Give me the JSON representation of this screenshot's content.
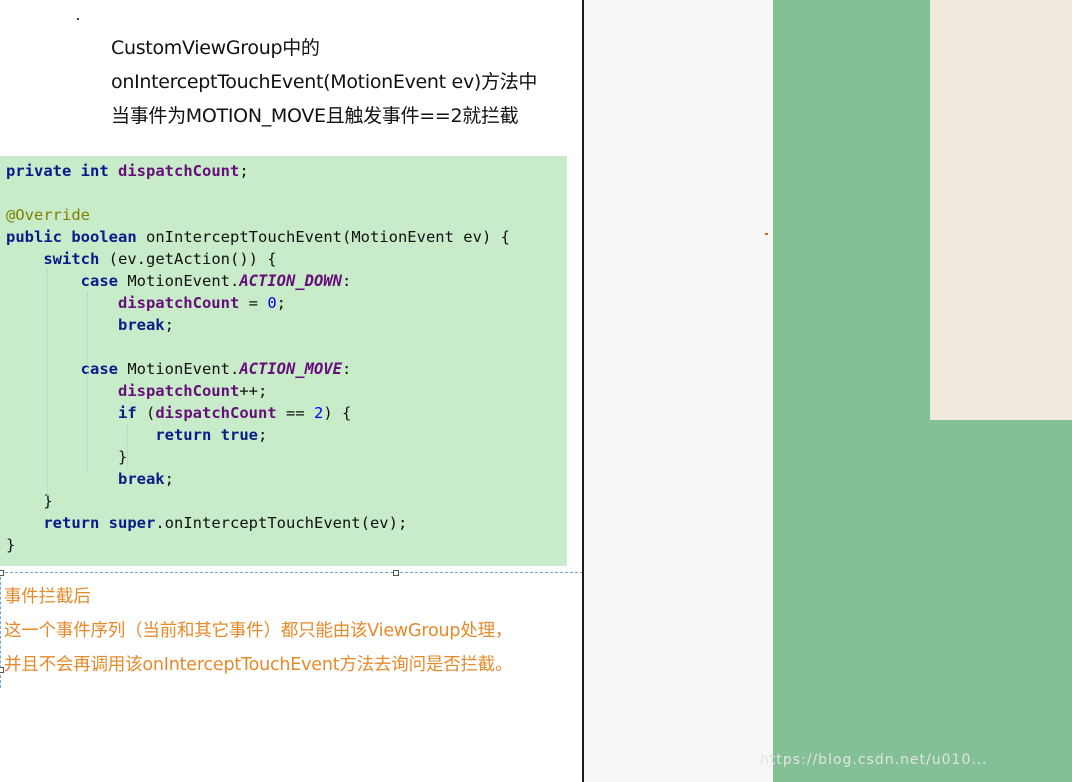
{
  "heading": {
    "line1": "CustomViewGroup中的",
    "line2": "onInterceptTouchEvent(MotionEvent ev)方法中",
    "line3": "当事件为MOTION_MOVE且触发事件==2就拦截"
  },
  "code": {
    "modifier_private": "private",
    "type_int": "int",
    "field": "dispatchCount",
    "annotation": "@Override",
    "modifier_public": "public",
    "type_boolean": "boolean",
    "method_sig": "onInterceptTouchEvent(MotionEvent ev) {",
    "kw_switch": "switch",
    "switch_expr": "(ev.getAction()) {",
    "kw_case": "case",
    "class_name": "MotionEvent.",
    "const_down": "ACTION_DOWN",
    "const_move": "ACTION_MOVE",
    "assign": " = ",
    "zero": "0",
    "kw_break": "break",
    "incr": "++;",
    "kw_if": "if",
    "eq": " == ",
    "two": "2",
    "kw_return": "return",
    "kw_true": "true",
    "kw_super": "super",
    "super_call": ".onInterceptTouchEvent(ev);"
  },
  "note": {
    "line1": "事件拦截后",
    "line2": "这一个事件序列（当前和其它事件）都只能由该ViewGroup处理，",
    "line3": "并且不会再调用该onInterceptTouchEvent方法去询问是否拦截。"
  },
  "phone_preview": {
    "watermark": "https://blog.csdn.net/u010...",
    "colors": {
      "outer_view": "#84c096",
      "inner_view": "#f1e9de",
      "background": "#f7f7f7"
    }
  }
}
